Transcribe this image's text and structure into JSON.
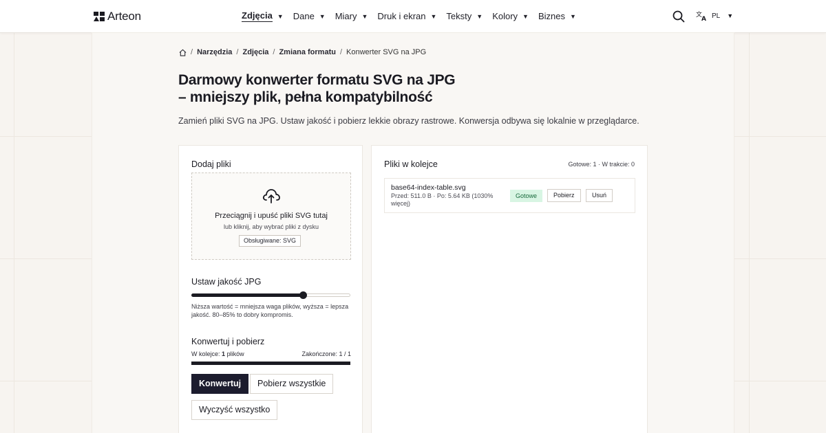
{
  "brand": {
    "name": "Arteon"
  },
  "nav": {
    "items": [
      {
        "label": "Zdjęcia",
        "active": true
      },
      {
        "label": "Dane"
      },
      {
        "label": "Miary"
      },
      {
        "label": "Druk i ekran"
      },
      {
        "label": "Teksty"
      },
      {
        "label": "Kolory"
      },
      {
        "label": "Biznes"
      }
    ],
    "language": "PL"
  },
  "breadcrumb": [
    "Narzędzia",
    "Zdjęcia",
    "Zmiana formatu",
    "Konwerter SVG na JPG"
  ],
  "page": {
    "title_line1": "Darmowy konwerter formatu SVG na JPG",
    "title_line2": "– mniejszy plik, pełna kompatybilność",
    "description": "Zamień pliki SVG na JPG. Ustaw jakość i pobierz lekkie obrazy rastrowe. Konwersja odbywa się lokalnie w przeglądarce."
  },
  "upload": {
    "title": "Dodaj pliki",
    "drop_text": "Przeciągnij i upuść pliki SVG tutaj",
    "drop_sub": "lub kliknij, aby wybrać pliki z dysku",
    "supported": "Obsługiwane: SVG"
  },
  "quality": {
    "title": "Ustaw jakość JPG",
    "value": 0.7,
    "hint": "Niższa wartość = mniejsza waga plików, wyższa = lepsza jakość. 80–85% to dobry kompromis."
  },
  "convert": {
    "title": "Konwertuj i pobierz",
    "queue_prefix": "W kolejce:",
    "queue_count": "1",
    "queue_suffix": "plików",
    "done_label": "Zakończone: 1 / 1",
    "progress": 1.0,
    "convert_btn": "Konwertuj",
    "download_all_btn": "Pobierz wszystkie",
    "clear_btn": "Wyczyść wszystko"
  },
  "queue": {
    "title": "Pliki w kolejce",
    "status": "Gotowe: 1 · W trakcie: 0",
    "files": [
      {
        "name": "base64-index-table.svg",
        "meta": "Przed: 511.0 B · Po: 5.64 KB (1030% więcej)",
        "status": "Gotowe",
        "download": "Pobierz",
        "remove": "Usuń"
      }
    ]
  },
  "colors": {
    "primary": "#1c1c2e",
    "success_bg": "#d8f5e3",
    "success_text": "#17693b"
  }
}
